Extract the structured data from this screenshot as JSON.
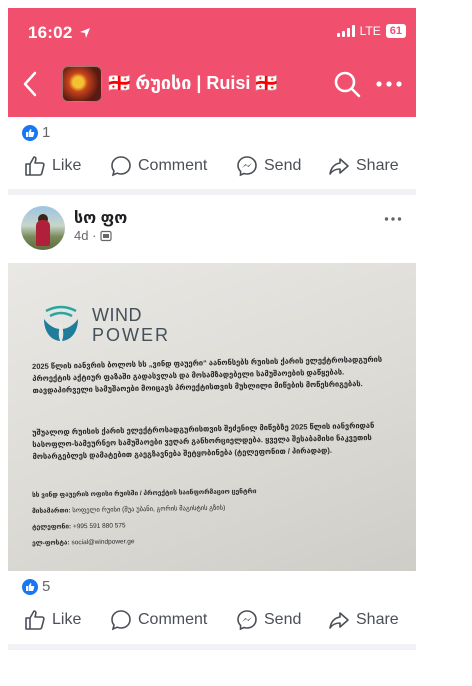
{
  "status_bar": {
    "time": "16:02",
    "network": "LTE",
    "battery": "61"
  },
  "header": {
    "group_name": "🇬🇪 რუისი | Ruisi 🇬🇪"
  },
  "post1": {
    "reaction_count": "1"
  },
  "actions": {
    "like": "Like",
    "comment": "Comment",
    "send": "Send",
    "share": "Share"
  },
  "post2": {
    "author": "სო ფო",
    "time_ago": "4d ·",
    "image": {
      "brand_line1": "WIND",
      "brand_line2": "POWER",
      "paragraph1": "2025 წლის იანვრის ბოლოს სს „ვინდ ფაუერი“ აანონსებს რუისის ქარის ელექტროსადგურის პროექტის აქტიურ ფაზაში გადასვლას და მოსამზადებელი სამუშაოების დაწყებას. თავდაპირველი სამუშაოები მოიცავს პროექტისთვის მუხლილი მიწების მოწესრიგებას.",
      "paragraph2": "უშუალოდ რუისის ქარის ელექტროსადგურისთვის შეძენილ მიწებზე 2025 წლის იანვრიდან სასოფლო-სამეურნეო სამუშაოები ვეღარ განხორციელდება. ყველა შესაბამისი ნაკვეთის მოსარგებლეს დამატებით გაეგზავნება შეტყობინება (ტელეფონით / პირადად).",
      "contact_title": "სს ვინდ ფაუერის ოფისი რუისში / პროექტის საინფორმაციო ცენტრი",
      "address_label": "მისამართი:",
      "address_value": "სოფელი რუისი (შუა უბანი, გორის მაგისტის გზის)",
      "phone_label": "ტელეფონი:",
      "phone_value": "+995 591 880 575",
      "email_label": "ელ-ფოსტა:",
      "email_value": "social@windpower.ge"
    },
    "reaction_count": "5"
  },
  "colors": {
    "header_bg": "#f0506e",
    "like_blue": "#1877f2"
  }
}
